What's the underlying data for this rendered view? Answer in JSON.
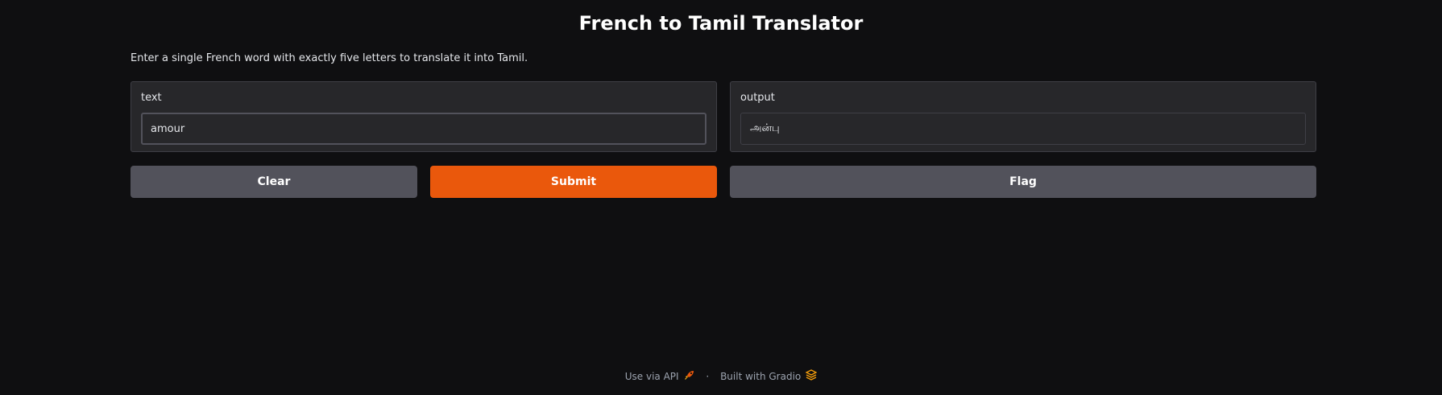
{
  "title": "French to Tamil Translator",
  "description": "Enter a single French word with exactly five letters to translate it into Tamil.",
  "input": {
    "label": "text",
    "value": "amour"
  },
  "output": {
    "label": "output",
    "value": "அன்பு"
  },
  "buttons": {
    "clear": "Clear",
    "submit": "Submit",
    "flag": "Flag"
  },
  "footer": {
    "api_link": "Use via API",
    "api_icon": "rocket-icon",
    "separator": "·",
    "built_with": "Built with Gradio",
    "gradio_icon": "gradio-logo-icon"
  },
  "colors": {
    "background": "#0f0f11",
    "panel": "#27272a",
    "secondary_button": "#52525b",
    "primary_button": "#ea580c"
  }
}
